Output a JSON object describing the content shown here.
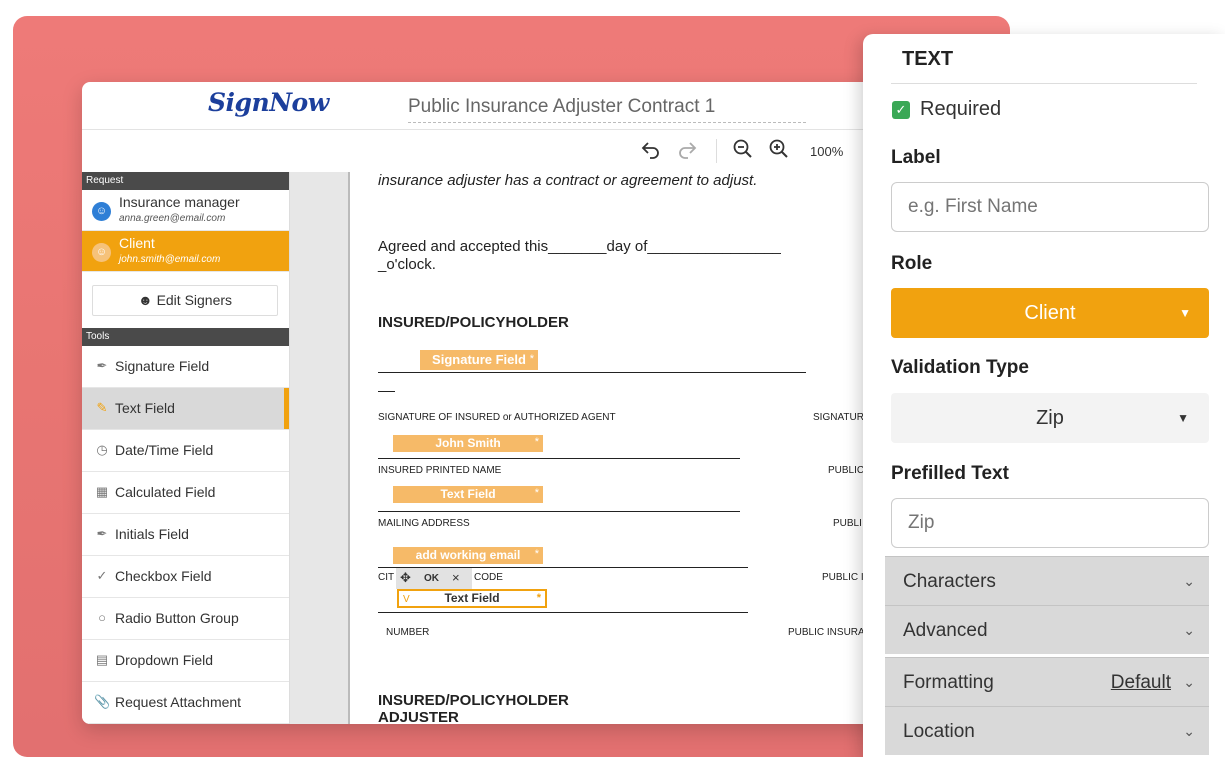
{
  "app": {
    "logo": "SignNow",
    "doc_title": "Public Insurance Adjuster Contract 1",
    "zoom": "100%"
  },
  "toolbar": {
    "undo_icon": "undo-icon",
    "redo_icon": "redo-icon",
    "zoom_out_icon": "zoom-out-icon",
    "zoom_in_icon": "zoom-in-icon"
  },
  "sidebar": {
    "request_header": "Request",
    "signers": [
      {
        "name": "Insurance manager",
        "email": "anna.green@email.com",
        "color": "#2f7fd6"
      },
      {
        "name": "Client",
        "email": "john.smith@email.com",
        "color": "#f1a20f"
      }
    ],
    "edit_signers": "Edit Signers",
    "tools_header": "Tools",
    "tools": [
      {
        "label": "Signature Field",
        "icon": "pen-icon"
      },
      {
        "label": "Text Field",
        "icon": "pencil-icon"
      },
      {
        "label": "Date/Time Field",
        "icon": "clock-icon"
      },
      {
        "label": "Calculated Field",
        "icon": "calculator-icon"
      },
      {
        "label": "Initials Field",
        "icon": "pen-icon"
      },
      {
        "label": "Checkbox Field",
        "icon": "check-icon"
      },
      {
        "label": "Radio Button Group",
        "icon": "radio-icon"
      },
      {
        "label": "Dropdown Field",
        "icon": "dropdown-icon"
      },
      {
        "label": "Request Attachment",
        "icon": "paperclip-icon"
      }
    ]
  },
  "document": {
    "line1": "insurance adjuster has a contract or agreement to adjust.",
    "agreed_a": "Agreed  and accepted this_______day  of________________",
    "agreed_b": "_o'clock.",
    "heading1": "INSURED/POLICYHOLDER",
    "sig_field": "Signature Field",
    "sig_label": "SIGNATURE  OF INSURED or AUTHORIZED AGENT",
    "sig_label_right": "SIGNATUR",
    "name_field": "John Smith",
    "printed_name": "INSURED  PRINTED  NAME",
    "printed_right": "PUBLIC",
    "text_field": "Text Field",
    "mailing": "MAILING   ADDRESS",
    "mailing_right": "PUBLI",
    "email_field": "add working email",
    "city_left": "CIT",
    "city_right_code": "CODE",
    "city_right": "PUBLIC I",
    "ok_label": "OK",
    "selected_field": "Text Field",
    "selected_v": "V",
    "number_left": "NUMBER",
    "number_right": "PUBLIC INSURA",
    "heading2a": "INSURED/POLICYHOLDER",
    "heading2b": "ADJUSTER",
    "asterisk": "*"
  },
  "panel": {
    "title": "TEXT",
    "required": "Required",
    "label_heading": "Label",
    "label_placeholder": "e.g. First Name",
    "role_heading": "Role",
    "role_value": "Client",
    "validation_heading": "Validation Type",
    "validation_value": "Zip",
    "prefilled_heading": "Prefilled Text",
    "prefilled_placeholder": "Zip",
    "sections": {
      "characters": "Characters",
      "advanced": "Advanced",
      "formatting": "Formatting",
      "formatting_value": "Default",
      "location": "Location"
    }
  },
  "colors": {
    "accent": "#f1a20f",
    "field": "#f6ba68",
    "background": "#ec7674",
    "logo": "#1c3f9c"
  }
}
